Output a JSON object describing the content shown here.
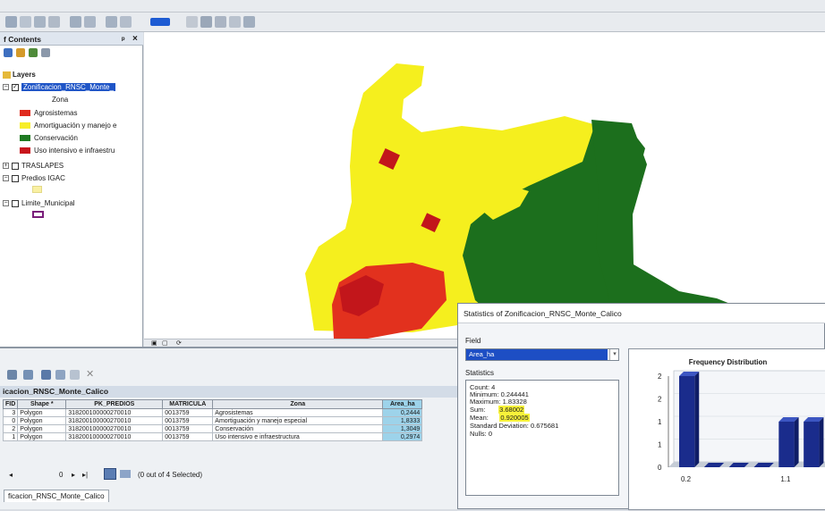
{
  "toc": {
    "title": "f Contents",
    "layers_label": "Layers",
    "layers": [
      {
        "name": "Zonificacion_RNSC_Monte_",
        "checked": true,
        "expanded": true,
        "field": "Zona",
        "classes": [
          {
            "label": "Agrosistemas",
            "color": "#e02b1e"
          },
          {
            "label": "Amortiguación y manejo e",
            "color": "#f7ee2a"
          },
          {
            "label": "Conservación",
            "color": "#1f7a21"
          },
          {
            "label": "Uso intensivo e infraestru",
            "color": "#c8151c"
          }
        ]
      },
      {
        "name": "TRASLAPES",
        "checked": false
      },
      {
        "name": "Predios IGAC",
        "checked": false,
        "swatch_color": "#f9f0a3"
      },
      {
        "name": "Limite_Municipal",
        "checked": false,
        "swatch_color": "#7a1d7a"
      }
    ]
  },
  "map": {
    "colors": {
      "yellow": "#f5ef1e",
      "green": "#1c6f1d",
      "red": "#e2311e",
      "dark_red": "#c2161b"
    }
  },
  "attribute_table": {
    "title": "icacion_RNSC_Monte_Calico",
    "columns": [
      "FID",
      "Shape *",
      "PK_PREDIOS",
      "MATRICULA",
      "Zona",
      "Area_ha"
    ],
    "rows": [
      [
        "3",
        "Polygon",
        "318200100000270010",
        "0013759",
        "Agrosistemas",
        "0,2444"
      ],
      [
        "0",
        "Polygon",
        "318200100000270010",
        "0013759",
        "Amortiguación y manejo especial",
        "1,8333"
      ],
      [
        "2",
        "Polygon",
        "318200100000270010",
        "0013759",
        "Conservación",
        "1,3049"
      ],
      [
        "1",
        "Polygon",
        "318200100000270010",
        "0013759",
        "Uso intensivo e infraestructura",
        "0,2974"
      ]
    ],
    "record": "0",
    "selection": "(0 out of 4 Selected)",
    "tab": "ficacion_RNSC_Monte_Calico"
  },
  "statistics": {
    "title": "Statistics of Zonificacion_RNSC_Monte_Calico",
    "field_label": "Field",
    "field_value": "Area_ha",
    "stats_heading": "Statistics",
    "lines": {
      "count": "Count:    4",
      "minimum": "Minimum:  0.244441",
      "maximum": "Maximum:  1.83328",
      "sum_label": "Sum:",
      "sum_value": "3.68002",
      "mean_label": "Mean:",
      "mean_value": "0.920005",
      "std": "Standard Deviation: 0.675681",
      "nulls": "Nulls:    0"
    }
  },
  "chart_data": {
    "type": "bar",
    "title": "Frequency Distribution",
    "categories": [
      "0.2",
      "",
      "",
      "",
      "1.1",
      ""
    ],
    "values": [
      2,
      0,
      0,
      0,
      1,
      1
    ],
    "ylim": [
      0,
      2
    ],
    "yticks": [
      "0",
      "1",
      "1",
      "2",
      "2"
    ],
    "bar_color": "#1a2c8c"
  }
}
